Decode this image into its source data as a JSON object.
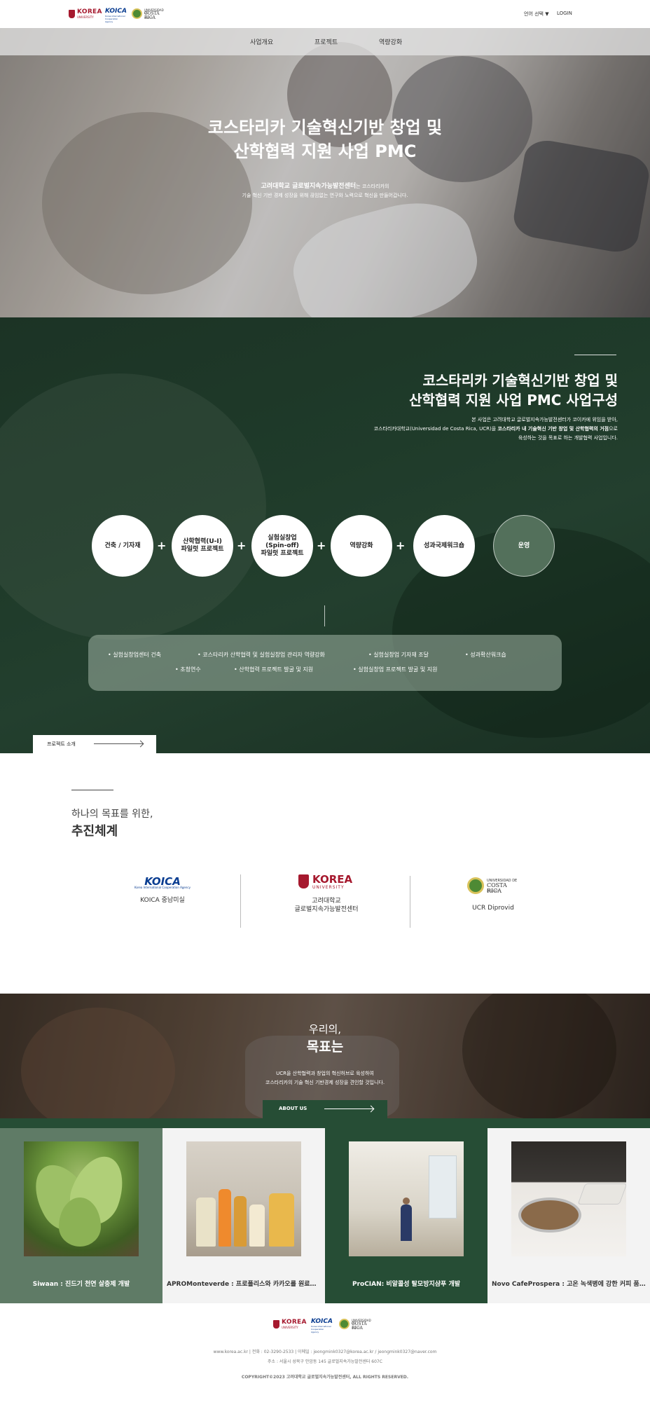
{
  "header": {
    "logos": {
      "korea": {
        "name": "KOREA",
        "sub": "UNIVERSITY"
      },
      "koica": {
        "name": "KOICA",
        "sub": "Korea International Cooperation Agency"
      },
      "ucr": {
        "top": "UNIVERSIDAD DE",
        "name": "COSTA RICA",
        "sub": "Diprovid"
      }
    },
    "lang_label": "언어 선택 ▼",
    "login_label": "LOGIN"
  },
  "nav": {
    "items": [
      "사업개요",
      "프로젝트",
      "역량강화"
    ]
  },
  "hero": {
    "title_line1": "코스타리카 기술혁신기반 창업 및",
    "title_line2": "산학협력 지원 사업 PMC",
    "sub_bold": "고려대학교 글로벌지속가능발전센터",
    "sub_line1_rest": "는 코스타리카의",
    "sub_line2": "기술 혁신 기반 경제 성장을 위해 끊임없는 연구와 노력으로 혁신을 만들어갑니다."
  },
  "composition": {
    "title_line1": "코스타리카 기술혁신기반 창업 및",
    "title_line2": "산학협력 지원 사업 PMC 사업구성",
    "desc_line1": "본 사업은 고려대학교 글로벌지속가능발전센터가 코이카에 위임을 받아,",
    "desc_line2_a": "코스타리카대학교(Universidad de Costa Rica, UCR)을 ",
    "desc_line2_b": "코스타리카 내 기술혁신 기반 창업 및 산학협력의 거점",
    "desc_line2_c": "으로",
    "desc_line3": "육성하는 것을 목표로 하는 개발협력 사업입니다.",
    "circles": [
      {
        "line1": "건축 / 기자재",
        "line2": "",
        "line3": ""
      },
      {
        "line1": "산학협력(U-I)",
        "line2": "파일럿 프로젝트",
        "line3": ""
      },
      {
        "line1": "실험실창업",
        "line2": "(Spin-off)",
        "line3": "파일럿 프로젝트"
      },
      {
        "line1": "역량강화",
        "line2": "",
        "line3": ""
      },
      {
        "line1": "성과국제워크숍",
        "line2": "",
        "line3": ""
      },
      {
        "line1": "운영",
        "line2": "",
        "line3": ""
      }
    ],
    "plus_symbol": "+",
    "tasks_row1": [
      "• 실험실창업센터 건축",
      "• 코스타리카 산학협력 및 실험실창업 관리자 역량강화",
      "• 실험실창업 기자재 조달",
      "• 성과확산워크숍"
    ],
    "tasks_row2": [
      "• 초청연수",
      "• 산학협력 프로젝트 발굴 및 지원",
      "• 실험실창업 프로젝트 발굴 및 지원"
    ],
    "project_tab_label": "프로젝트 소개"
  },
  "system": {
    "subtitle": "하나의 목표를 위한,",
    "title": "추진체계",
    "orgs": [
      {
        "name": "KOICA 중남미실"
      },
      {
        "name_line1": "고려대학교",
        "name_line2": "글로벌지속가능발전센터"
      },
      {
        "name": "UCR Diprovid"
      }
    ]
  },
  "goals": {
    "subtitle": "우리의,",
    "title": "목표는",
    "desc_line1": "UCR을 산학협력과 창업의 혁신허브로 육성하여",
    "desc_line2": "코스타리카의 기술 혁신 기반경제 성장을 견인할 것입니다.",
    "about_label": "ABOUT US"
  },
  "projects": [
    {
      "caption": "Siwaan : 진드기 천연 살충제 개발",
      "bg": "#5f7b66",
      "fg": "#ffffff"
    },
    {
      "caption": "APROMonteverde : 프로폴리스와 카카오를 원료로 한 천연 비누 개발",
      "bg": "#f3f3f3",
      "fg": "#333333"
    },
    {
      "caption": "ProCIAN: 비알콜성 탈모방지샴푸 개발",
      "bg": "#264d35",
      "fg": "#ffffff"
    },
    {
      "caption": "Novo CafeProspera : 고온 녹색병에 강한 커피 품종 개발",
      "bg": "#f3f3f3",
      "fg": "#333333"
    }
  ],
  "footer": {
    "info": "www.korea.ac.kr  |  전화 : 02-3290-2533  |  이메일 : jeongmink0327@korea.ac.kr / jeongmink0327@naver.com",
    "address": "주소 : 서울시 성북구 안암동 145 글로벌지속가능발전센터 607C",
    "copyright": "COPYRIGHT©2023 고려대학교 글로벌지속가능발전센터, ALL RIGHTS RESERVED."
  }
}
